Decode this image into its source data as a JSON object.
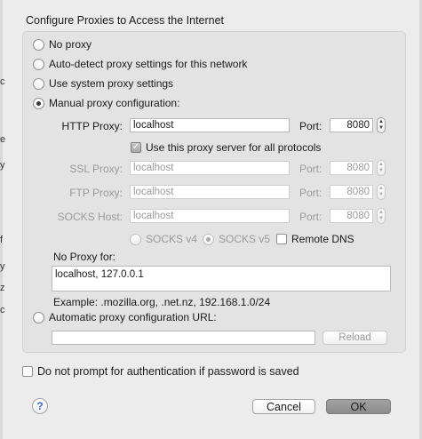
{
  "header": "Configure Proxies to Access the Internet",
  "options": {
    "no_proxy": "No proxy",
    "auto_detect": "Auto-detect proxy settings for this network",
    "system": "Use system proxy settings",
    "manual": "Manual proxy configuration:",
    "auto_url": "Automatic proxy configuration URL:"
  },
  "selected_option": "manual",
  "http": {
    "label": "HTTP Proxy:",
    "value": "localhost",
    "port_label": "Port:",
    "port": "8080"
  },
  "use_all": {
    "label": "Use this proxy server for all protocols",
    "checked": true
  },
  "ssl": {
    "label": "SSL Proxy:",
    "value": "localhost",
    "port_label": "Port:",
    "port": "8080"
  },
  "ftp": {
    "label": "FTP Proxy:",
    "value": "localhost",
    "port_label": "Port:",
    "port": "8080"
  },
  "socks": {
    "label": "SOCKS Host:",
    "value": "localhost",
    "port_label": "Port:",
    "port": "8080"
  },
  "socks_version": {
    "v4": "SOCKS v4",
    "v5": "SOCKS v5",
    "selected": "v5"
  },
  "remote_dns": {
    "label": "Remote DNS",
    "checked": false
  },
  "no_proxy_for": {
    "label": "No Proxy for:",
    "value": "localhost, 127.0.0.1"
  },
  "example": "Example: .mozilla.org, .net.nz, 192.168.1.0/24",
  "auto_url_value": "",
  "reload_label": "Reload",
  "no_prompt": {
    "label": "Do not prompt for authentication if password is saved",
    "checked": false
  },
  "help_label": "?",
  "cancel_label": "Cancel",
  "ok_label": "OK",
  "edge_chars": [
    "c",
    "e",
    "y",
    "f",
    "y",
    "z",
    "c"
  ]
}
